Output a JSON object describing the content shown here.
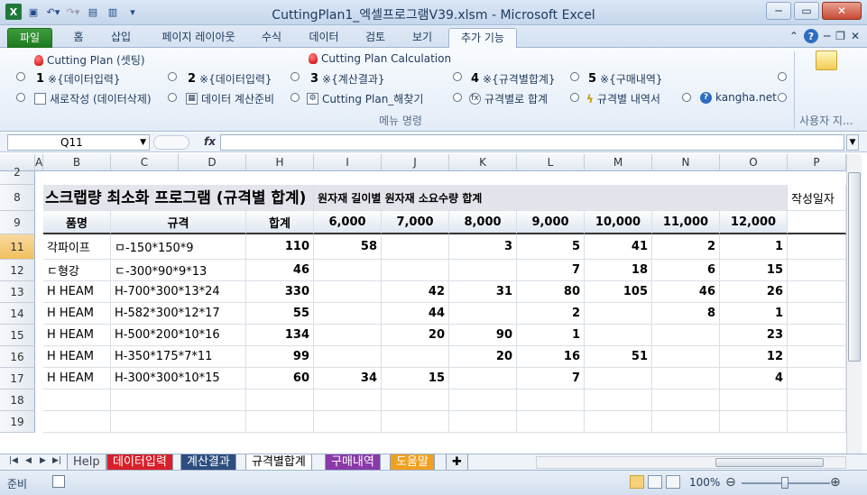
{
  "window": {
    "title": "CuttingPlan1_엑셀프로그램V39.xlsm  -  Microsoft Excel"
  },
  "tabs": [
    "파일",
    "홈",
    "삽입",
    "페이지 레이아웃",
    "수식",
    "데이터",
    "검토",
    "보기",
    "추가 기능"
  ],
  "ribbon": {
    "row1": [
      "Cutting Plan (셋팅)",
      "Cutting Plan Calculation"
    ],
    "row2": [
      {
        "num": "1",
        "label": "※{데이터입력}"
      },
      {
        "num": "2",
        "label": "※{데이터입력}"
      },
      {
        "num": "3",
        "label": "※{계산결과}"
      },
      {
        "num": "4",
        "label": "※{규격별합계}"
      },
      {
        "num": "5",
        "label": "※{구매내역}"
      }
    ],
    "row3": [
      "새로작성 (데이터삭제)",
      "데이터 계산준비",
      "Cutting Plan_해찾기",
      "규격별로 합계",
      "규격별 내역서",
      "kangha.net"
    ],
    "group_label": "메뉴 명령",
    "user_group_label": "사용자 지..."
  },
  "formula": {
    "name_box": "Q11",
    "fx": "fx",
    "value": ""
  },
  "columns": [
    "A",
    "B",
    "C",
    "D",
    "H",
    "I",
    "J",
    "K",
    "L",
    "M",
    "N",
    "O",
    "P"
  ],
  "rows": [
    "2",
    "8",
    "9",
    "11",
    "12",
    "13",
    "14",
    "15",
    "16",
    "17",
    "18",
    "19"
  ],
  "sheet": {
    "title": "스크랩량 최소화 프로그램 (규격별 합계)",
    "group_header": "원자재 길이별 원자재 소요수량 합계",
    "written_date": "작성일자",
    "headers": [
      "품명",
      "규격",
      "합계",
      "6,000",
      "7,000",
      "8,000",
      "9,000",
      "10,000",
      "11,000",
      "12,000"
    ],
    "data": [
      [
        "각파이프",
        "ㅁ-150*150*9",
        "110",
        "58",
        "",
        "3",
        "5",
        "41",
        "2",
        "1"
      ],
      [
        "ㄷ형강",
        "ㄷ-300*90*9*13",
        "46",
        "",
        "",
        "",
        "7",
        "18",
        "6",
        "15"
      ],
      [
        "H HEAM",
        "H-700*300*13*24",
        "330",
        "",
        "42",
        "31",
        "80",
        "105",
        "46",
        "26"
      ],
      [
        "H HEAM",
        "H-582*300*12*17",
        "55",
        "",
        "44",
        "",
        "2",
        "",
        "8",
        "1"
      ],
      [
        "H HEAM",
        "H-500*200*10*16",
        "134",
        "",
        "20",
        "90",
        "1",
        "",
        "",
        "23"
      ],
      [
        "H HEAM",
        "H-350*175*7*11",
        "99",
        "",
        "",
        "20",
        "16",
        "51",
        "",
        "12"
      ],
      [
        "H HEAM",
        "H-300*300*10*15",
        "60",
        "34",
        "15",
        "",
        "7",
        "",
        "",
        "4"
      ]
    ]
  },
  "sheet_tabs": [
    "Help",
    "데이터입력",
    "계산결과",
    "규격별합계",
    "구매내역",
    "도움말"
  ],
  "status": {
    "ready": "준비",
    "zoom": "100%"
  }
}
